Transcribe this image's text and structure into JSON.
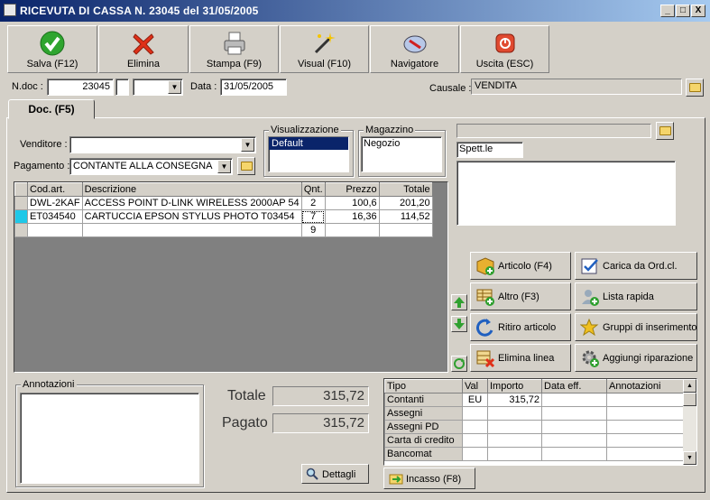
{
  "window": {
    "title": "RICEVUTA DI CASSA N. 23045  del 31/05/2005",
    "min": "_",
    "max": "□",
    "close": "X"
  },
  "toolbar": [
    {
      "label": "Salva (F12)",
      "icon": "check-icon"
    },
    {
      "label": "Elimina",
      "icon": "delete-x-icon"
    },
    {
      "label": "Stampa (F9)",
      "icon": "printer-icon"
    },
    {
      "label": "Visual (F10)",
      "icon": "magic-wand-icon"
    },
    {
      "label": "Navigatore",
      "icon": "compass-icon"
    },
    {
      "label": "Uscita (ESC)",
      "icon": "power-icon"
    }
  ],
  "header": {
    "ndoc_label": "N.doc :",
    "ndoc_value": "23045",
    "data_label": "Data :",
    "data_value": "31/05/2005",
    "causale_label": "Causale :",
    "causale_value": "VENDITA"
  },
  "tab": {
    "label": "Doc. (F5)"
  },
  "form": {
    "venditore_label": "Venditore :",
    "venditore_value": "",
    "pagamento_label": "Pagamento :",
    "pagamento_value": "CONTANTE ALLA CONSEGNA",
    "visualizzazione_title": "Visualizzazione",
    "visualizzazione_selected": "Default",
    "magazzino_title": "Magazzino",
    "magazzino_value": "Negozio",
    "spett_value": "Spett.le"
  },
  "grid": {
    "headers": [
      "Cod.art.",
      "Descrizione",
      "Qnt.",
      "Prezzo",
      "Totale"
    ],
    "rows": [
      {
        "cod": "DWL-2KAF",
        "desc": "ACCESS POINT D-LINK WIRELESS 2000AP 54",
        "qnt": "2",
        "prezzo": "100,6",
        "totale": "201,20"
      },
      {
        "cod": "ET034540",
        "desc": "CARTUCCIA EPSON STYLUS PHOTO T03454",
        "qnt": "7",
        "prezzo": "16,36",
        "totale": "114,52"
      },
      {
        "cod": "",
        "desc": "",
        "qnt": "9",
        "prezzo": "",
        "totale": ""
      }
    ]
  },
  "actions": [
    {
      "label": "Articolo (F4)",
      "icon": "box-add-icon"
    },
    {
      "label": "Carica da Ord.cl.",
      "icon": "checklist-icon"
    },
    {
      "label": "Altro (F3)",
      "icon": "table-add-icon"
    },
    {
      "label": "Lista rapida",
      "icon": "user-list-icon"
    },
    {
      "label": "Ritiro articolo",
      "icon": "return-arrow-icon"
    },
    {
      "label": "Gruppi di inserimento",
      "icon": "star-group-icon"
    },
    {
      "label": "Elimina linea",
      "icon": "delete-row-icon"
    },
    {
      "label": "Aggiungi riparazione",
      "icon": "gear-add-icon"
    }
  ],
  "annotazioni": {
    "title": "Annotazioni",
    "value": ""
  },
  "totals": {
    "totale_label": "Totale",
    "totale_value": "315,72",
    "pagato_label": "Pagato",
    "pagato_value": "315,72",
    "dettagli_label": "Dettagli"
  },
  "payments": {
    "headers": [
      "Tipo",
      "Val",
      "Importo",
      "Data eff.",
      "Annotazioni"
    ],
    "rows": [
      {
        "tipo": "Contanti",
        "val": "EU",
        "importo": "315,72"
      },
      {
        "tipo": "Assegni",
        "val": "",
        "importo": ""
      },
      {
        "tipo": "Assegni PD",
        "val": "",
        "importo": ""
      },
      {
        "tipo": "Carta di credito",
        "val": "",
        "importo": ""
      },
      {
        "tipo": "Bancomat",
        "val": "",
        "importo": ""
      }
    ]
  },
  "incasso": {
    "label": "Incasso (F8)"
  }
}
